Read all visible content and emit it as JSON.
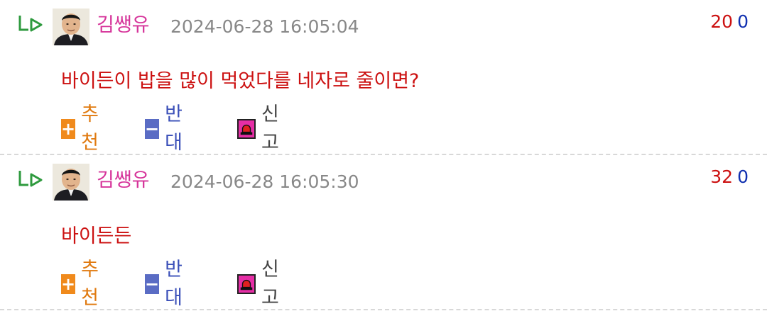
{
  "comments": [
    {
      "author": "김쌩유",
      "datetime": "2024-06-28 16:05:04",
      "up_votes": "20",
      "down_votes": "0",
      "text": "바이든이 밥을 많이 먹었다를 네자로 줄이면?",
      "actions": {
        "recommend": "추천",
        "oppose": "반대",
        "report": "신고"
      }
    },
    {
      "author": "김쌩유",
      "datetime": "2024-06-28 16:05:30",
      "up_votes": "32",
      "down_votes": "0",
      "text": "바이든든",
      "actions": {
        "recommend": "추천",
        "oppose": "반대",
        "report": "신고"
      }
    }
  ],
  "icons": {
    "reply": "reply-arrow-icon",
    "recommend": "plus-icon",
    "oppose": "minus-icon",
    "report": "siren-icon"
  },
  "colors": {
    "author": "#d6349a",
    "comment_text": "#cc1111",
    "up_votes": "#cc1111",
    "down_votes": "#1030b0",
    "recommend": "#f08a1c",
    "oppose": "#5a6cc4",
    "report": "#e62ea6"
  }
}
